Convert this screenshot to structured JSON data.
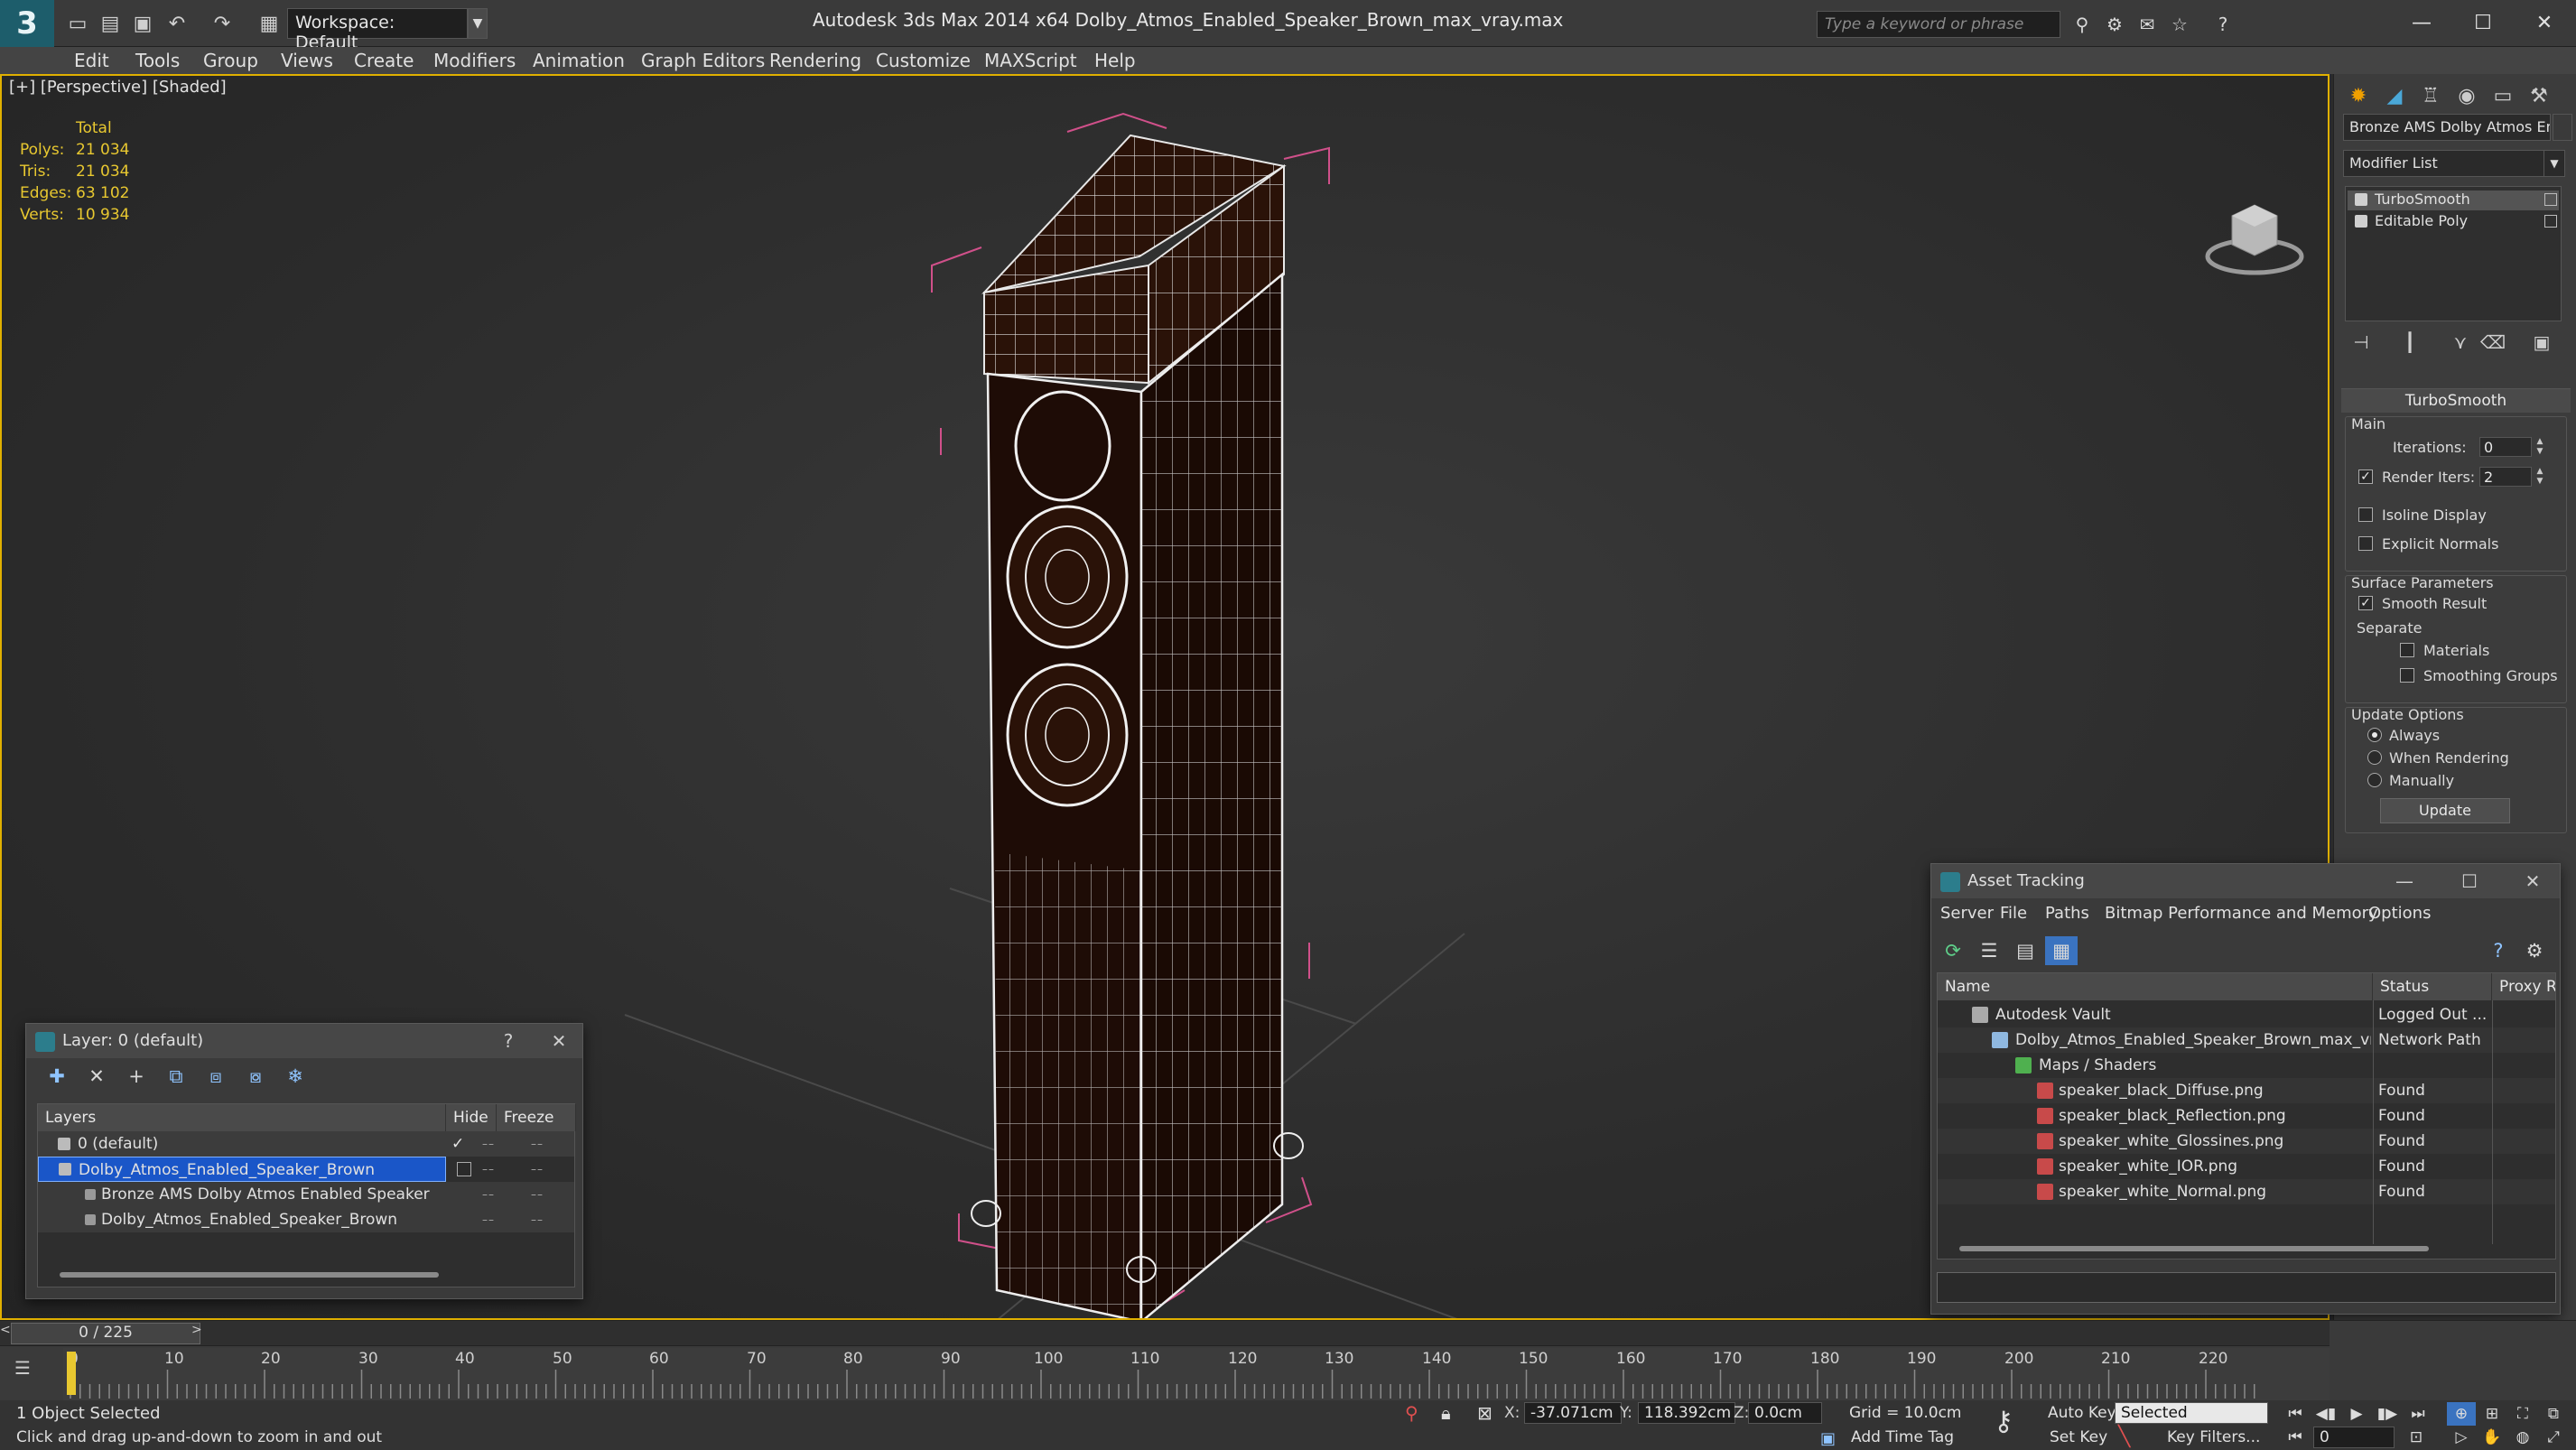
{
  "app": {
    "logo": "3",
    "title": "Autodesk 3ds Max  2014 x64    Dolby_Atmos_Enabled_Speaker_Brown_max_vray.max",
    "workspace": "Workspace: Default",
    "search_placeholder": "Type a keyword or phrase"
  },
  "menu": [
    "Edit",
    "Tools",
    "Group",
    "Views",
    "Create",
    "Modifiers",
    "Animation",
    "Graph Editors",
    "Rendering",
    "Customize",
    "MAXScript",
    "Help"
  ],
  "viewport": {
    "label": "[+] [Perspective] [Shaded]",
    "stats": {
      "header": "Total",
      "rows": [
        {
          "label": "Polys:",
          "value": "21 034"
        },
        {
          "label": "Tris:",
          "value": "21 034"
        },
        {
          "label": "Edges:",
          "value": "63 102"
        },
        {
          "label": "Verts:",
          "value": "10 934"
        }
      ]
    }
  },
  "command_panel": {
    "object_name": "Bronze AMS Dolby Atmos Ena",
    "modifier_list": "Modifier List",
    "stack": [
      "TurboSmooth",
      "Editable Poly"
    ],
    "rollout": {
      "title": "TurboSmooth",
      "main": "Main",
      "iterations_label": "Iterations:",
      "iterations": "0",
      "render_iters_label": "Render Iters:",
      "render_iters": "2",
      "isoline": "Isoline Display",
      "explicit": "Explicit Normals",
      "surface": "Surface Parameters",
      "smooth": "Smooth Result",
      "separate": "Separate",
      "materials": "Materials",
      "smoothing": "Smoothing Groups",
      "update_options": "Update Options",
      "always": "Always",
      "when_rendering": "When Rendering",
      "manually": "Manually",
      "update_btn": "Update"
    }
  },
  "layer_panel": {
    "title": "Layer: 0 (default)",
    "help": "?",
    "columns": [
      "Layers",
      "Hide",
      "Freeze"
    ],
    "rows": [
      {
        "name": "0 (default)",
        "selected": false
      },
      {
        "name": "Dolby_Atmos_Enabled_Speaker_Brown",
        "selected": true
      },
      {
        "name": "Bronze AMS Dolby Atmos Enabled Speaker",
        "selected": false
      },
      {
        "name": "Dolby_Atmos_Enabled_Speaker_Brown",
        "selected": false
      }
    ]
  },
  "asset_panel": {
    "title": "Asset Tracking",
    "menu": [
      "Server",
      "File",
      "Paths",
      "Bitmap Performance and Memory",
      "Options"
    ],
    "columns": [
      "Name",
      "Status",
      "Proxy R"
    ],
    "rows": [
      {
        "name": "Autodesk Vault",
        "status": "Logged Out ..."
      },
      {
        "name": "Dolby_Atmos_Enabled_Speaker_Brown_max_vra...",
        "status": "Network Path"
      },
      {
        "name": "Maps / Shaders",
        "status": ""
      },
      {
        "name": "speaker_black_Diffuse.png",
        "status": "Found"
      },
      {
        "name": "speaker_black_Reflection.png",
        "status": "Found"
      },
      {
        "name": "speaker_white_Glossines.png",
        "status": "Found"
      },
      {
        "name": "speaker_white_IOR.png",
        "status": "Found"
      },
      {
        "name": "speaker_white_Normal.png",
        "status": "Found"
      }
    ]
  },
  "timeline": {
    "position": "0 / 225",
    "ticks": [
      "0",
      "10",
      "20",
      "30",
      "40",
      "50",
      "60",
      "70",
      "80",
      "90",
      "100",
      "110",
      "120",
      "130",
      "140",
      "150",
      "160",
      "170",
      "180",
      "190",
      "200",
      "210",
      "220"
    ]
  },
  "status": {
    "selection": "1 Object Selected",
    "prompt": "Click and drag up-and-down to zoom in and out",
    "x_label": "X:",
    "x": "-37.071cm",
    "y_label": "Y:",
    "y": "118.392cm",
    "z_label": "Z:",
    "z": "0.0cm",
    "grid": "Grid = 10.0cm",
    "auto_key": "Auto Key",
    "set_key": "Set Key",
    "selected_opt": "Selected",
    "key_filters": "Key Filters...",
    "add_time_tag": "Add Time Tag",
    "frame": "0"
  },
  "colors": {
    "accent": "#e8c830",
    "viewport_border": "#e0b000",
    "selection": "#1a56c8"
  }
}
